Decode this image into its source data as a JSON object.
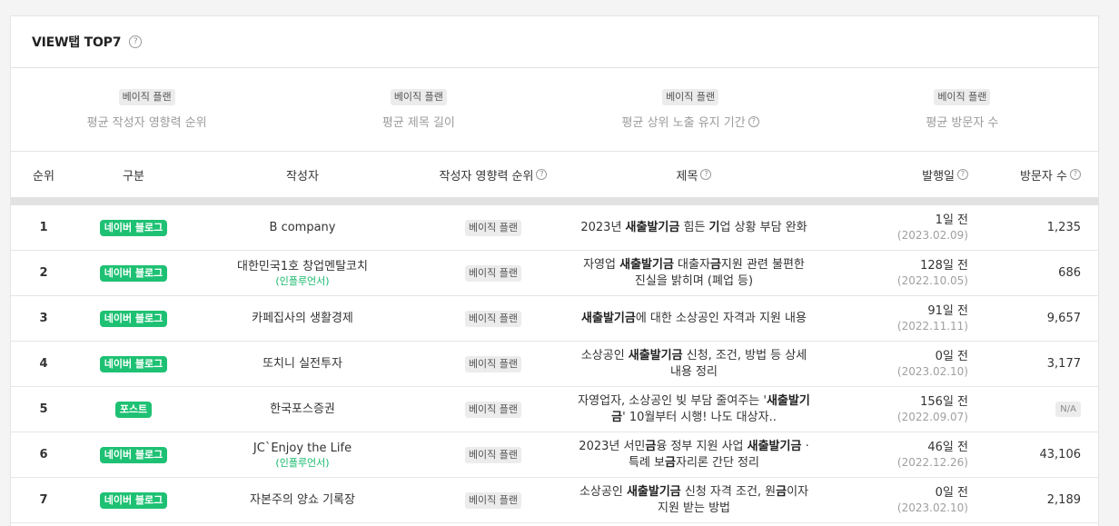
{
  "header": {
    "title": "VIEW탭 TOP7",
    "help_glyph": "?"
  },
  "summary": [
    {
      "tag": "베이직 플랜",
      "label": "평균 작성자 영향력 순위",
      "has_help": false
    },
    {
      "tag": "베이직 플랜",
      "label": "평균 제목 길이",
      "has_help": false
    },
    {
      "tag": "베이직 플랜",
      "label": "평균 상위 노출 유지 기간",
      "has_help": true
    },
    {
      "tag": "베이직 플랜",
      "label": "평균 방문자 수",
      "has_help": false
    }
  ],
  "columns": {
    "rank": "순위",
    "type": "구분",
    "author": "작성자",
    "influence": "작성자 영향력 순위",
    "title": "제목",
    "date": "발행일",
    "visitors": "방문자 수"
  },
  "rows": [
    {
      "rank": "1",
      "type": "네이버 블로그",
      "author": "B company",
      "author_sub": "",
      "influence": "베이직 플랜",
      "title_segments": [
        {
          "t": "2023년 "
        },
        {
          "t": "새출발기금",
          "b": true
        },
        {
          "t": " 힘든 "
        },
        {
          "t": "기",
          "b": true
        },
        {
          "t": "업 상황 부담 완화"
        }
      ],
      "date": "1일 전",
      "date_sub": "(2023.02.09)",
      "visitors": "1,235",
      "visitors_na": false
    },
    {
      "rank": "2",
      "type": "네이버 블로그",
      "author": "대한민국1호 창업멘탈코치",
      "author_sub": "(인플루언서)",
      "influence": "베이직 플랜",
      "title_segments": [
        {
          "t": "자영업 "
        },
        {
          "t": "새출발기금",
          "b": true
        },
        {
          "t": " 대출자"
        },
        {
          "t": "금",
          "b": true
        },
        {
          "t": "지원 관련 불편한 진실을 밝히며 (폐업 등)"
        }
      ],
      "date": "128일 전",
      "date_sub": "(2022.10.05)",
      "visitors": "686",
      "visitors_na": false
    },
    {
      "rank": "3",
      "type": "네이버 블로그",
      "author": "카페집사의 생활경제",
      "author_sub": "",
      "influence": "베이직 플랜",
      "title_segments": [
        {
          "t": "새출발기금",
          "b": true
        },
        {
          "t": "에 대한 소상공인 자격과 지원 내용"
        }
      ],
      "date": "91일 전",
      "date_sub": "(2022.11.11)",
      "visitors": "9,657",
      "visitors_na": false
    },
    {
      "rank": "4",
      "type": "네이버 블로그",
      "author": "또치니 실전투자",
      "author_sub": "",
      "influence": "베이직 플랜",
      "title_segments": [
        {
          "t": "소상공인 "
        },
        {
          "t": "새출발기금",
          "b": true
        },
        {
          "t": " 신청, 조건, 방법 등 상세내용 정리"
        }
      ],
      "date": "0일 전",
      "date_sub": "(2023.02.10)",
      "visitors": "3,177",
      "visitors_na": false
    },
    {
      "rank": "5",
      "type": "포스트",
      "author": "한국포스증권",
      "author_sub": "",
      "influence": "베이직 플랜",
      "title_segments": [
        {
          "t": "자영업자, 소상공인 빚 부담 줄여주는 '"
        },
        {
          "t": "새출발기금",
          "b": true
        },
        {
          "t": "' 10월부터 시행! 나도 대상자.."
        }
      ],
      "date": "156일 전",
      "date_sub": "(2022.09.07)",
      "visitors": "N/A",
      "visitors_na": true
    },
    {
      "rank": "6",
      "type": "네이버 블로그",
      "author": "JC`Enjoy the Life",
      "author_sub": "(인플루언서)",
      "influence": "베이직 플랜",
      "title_segments": [
        {
          "t": "2023년 서민"
        },
        {
          "t": "금",
          "b": true
        },
        {
          "t": "융 정부 지원 사업 "
        },
        {
          "t": "새출발기금",
          "b": true
        },
        {
          "t": " · 특례 보"
        },
        {
          "t": "금",
          "b": true
        },
        {
          "t": "자리론 간단 정리"
        }
      ],
      "date": "46일 전",
      "date_sub": "(2022.12.26)",
      "visitors": "43,106",
      "visitors_na": false
    },
    {
      "rank": "7",
      "type": "네이버 블로그",
      "author": "자본주의 양쇼 기록장",
      "author_sub": "",
      "influence": "베이직 플랜",
      "title_segments": [
        {
          "t": "소상공인 "
        },
        {
          "t": "새출발기금",
          "b": true
        },
        {
          "t": " 신청 자격 조건, 원"
        },
        {
          "t": "금",
          "b": true
        },
        {
          "t": "이자 지원 받는 방법"
        }
      ],
      "date": "0일 전",
      "date_sub": "(2023.02.10)",
      "visitors": "2,189",
      "visitors_na": false
    }
  ],
  "colors": {
    "accent_green": "#1ec173",
    "influencer_green": "#14b86a",
    "muted_text": "#9b9b9b"
  }
}
